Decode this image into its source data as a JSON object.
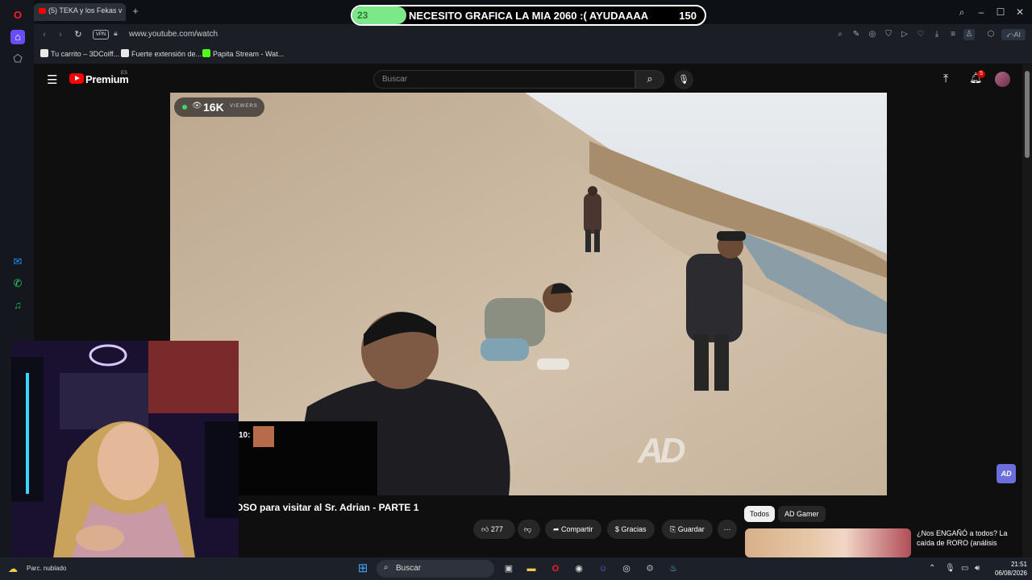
{
  "browser": {
    "tab_title": "(5) TEKA y los Fekas v",
    "url": "www.youtube.com/watch",
    "vpn_label": "VPN",
    "ai_label": "AI",
    "bookmarks": [
      {
        "label": "Tu carrito – 3DCoiff...",
        "color": "#e8e8e8"
      },
      {
        "label": "Fuerte extensión de...",
        "color": "#e8e8e8"
      },
      {
        "label": "Papita Stream - Wat...",
        "color": "#53fc18"
      }
    ]
  },
  "goal": {
    "current": "23",
    "title": "NECESITO GRAFICA LA MIA 2060 :( AYUDAAAA",
    "target": "150",
    "progress_fraction": 0.153,
    "fill_color": "#7de88a"
  },
  "youtube": {
    "brand": "Premium",
    "region": "ES",
    "search_placeholder": "Buscar",
    "notif_count": "5",
    "viewers": {
      "count": "16K",
      "label": "VIEWERS"
    },
    "video_watermark": "AD",
    "video_title": "OSO para visitar al Sr. Adrian - PARTE 1",
    "actions": {
      "likes": "277",
      "share": "Compartir",
      "thanks": "Gracias",
      "save": "Guardar",
      "more": "⋯"
    },
    "chips": {
      "all": "Todos",
      "channel": "AD Gamer"
    },
    "recommendation": {
      "title": "¿Nos ENGAÑÓ a todos? La caída de RORO (análisis"
    },
    "corner_logo": "AD"
  },
  "stream_overlay": {
    "chat_time": "10:"
  },
  "taskbar": {
    "weather": "Parc. nublado",
    "search_label": "Buscar",
    "time": "21:51",
    "date": "06/08/2026"
  },
  "colors": {
    "yt_red": "#ff0000",
    "goal_fill": "#7de88a"
  }
}
